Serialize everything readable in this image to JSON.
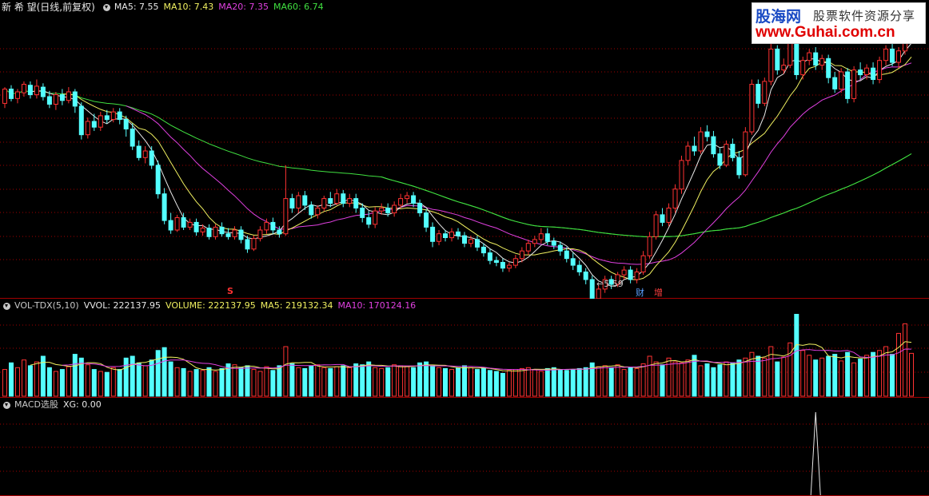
{
  "main_panel": {
    "title": "新 希 望(日线,前复权)",
    "ma_labels": [
      {
        "text": "MA5: 7.55",
        "color": "#e8e8e8"
      },
      {
        "text": "MA10: 7.43",
        "color": "#f0f060"
      },
      {
        "text": "MA20: 7.35",
        "color": "#e040e0"
      },
      {
        "text": "MA60: 6.74",
        "color": "#40e040"
      }
    ],
    "annotations": {
      "low_price": "5.59",
      "marker_s": "S",
      "marker_cai": "财",
      "marker_zeng": "增"
    }
  },
  "volume_panel": {
    "title": "VOL-TDX(5,10)",
    "labels": [
      {
        "text": "VVOL: 222137.95",
        "color": "#e8e8e8"
      },
      {
        "text": "VOLUME: 222137.95",
        "color": "#f0f060"
      },
      {
        "text": "MA5: 219132.34",
        "color": "#f0f060"
      },
      {
        "text": "MA10: 170124.16",
        "color": "#e040e0"
      }
    ]
  },
  "indicator_panel": {
    "title": "MACD选股",
    "labels": [
      {
        "text": "XG: 0.00",
        "color": "#e8e8e8"
      }
    ]
  },
  "watermark": {
    "brand": "股海网",
    "slogan": "股票软件资源分享",
    "url": "www.Guhai.com.cn"
  },
  "colors": {
    "up": "#ff3232",
    "down": "#54ffff",
    "ma5": "#e8e8e8",
    "ma10": "#f0f060",
    "ma20": "#e040e0",
    "ma60": "#40e040",
    "grid": "#a00000"
  },
  "chart_data": {
    "type": "candlestick",
    "price_range": [
      5.3,
      8.05
    ],
    "candles": [
      [
        7.15,
        7.3,
        7.32,
        7.1
      ],
      [
        7.3,
        7.2,
        7.34,
        7.17
      ],
      [
        7.2,
        7.27,
        7.3,
        7.15
      ],
      [
        7.26,
        7.35,
        7.38,
        7.22
      ],
      [
        7.34,
        7.24,
        7.38,
        7.2
      ],
      [
        7.24,
        7.33,
        7.4,
        7.2
      ],
      [
        7.32,
        7.22,
        7.36,
        7.18
      ],
      [
        7.22,
        7.14,
        7.28,
        7.1
      ],
      [
        7.14,
        7.24,
        7.27,
        7.08
      ],
      [
        7.24,
        7.18,
        7.3,
        7.13
      ],
      [
        7.18,
        7.27,
        7.32,
        7.15
      ],
      [
        7.27,
        7.12,
        7.3,
        7.05
      ],
      [
        7.12,
        6.82,
        7.16,
        6.77
      ],
      [
        6.82,
        6.96,
        7.0,
        6.78
      ],
      [
        6.96,
        6.9,
        7.04,
        6.86
      ],
      [
        6.9,
        7.02,
        7.06,
        6.86
      ],
      [
        7.02,
        6.98,
        7.08,
        6.94
      ],
      [
        6.98,
        7.06,
        7.1,
        6.95
      ],
      [
        7.06,
        6.98,
        7.1,
        6.93
      ],
      [
        6.98,
        6.88,
        7.02,
        6.8
      ],
      [
        6.88,
        6.7,
        6.94,
        6.66
      ],
      [
        6.7,
        6.58,
        6.76,
        6.55
      ],
      [
        6.58,
        6.65,
        6.7,
        6.52
      ],
      [
        6.65,
        6.5,
        6.7,
        6.46
      ],
      [
        6.5,
        6.2,
        6.55,
        6.15
      ],
      [
        6.2,
        5.92,
        6.26,
        5.88
      ],
      [
        5.92,
        5.82,
        6.0,
        5.78
      ],
      [
        5.82,
        5.95,
        5.98,
        5.8
      ],
      [
        5.95,
        5.85,
        6.0,
        5.82
      ],
      [
        5.85,
        5.9,
        5.94,
        5.82
      ],
      [
        5.9,
        5.8,
        5.94,
        5.76
      ],
      [
        5.8,
        5.84,
        5.88,
        5.76
      ],
      [
        5.84,
        5.75,
        5.88,
        5.72
      ],
      [
        5.75,
        5.85,
        5.88,
        5.72
      ],
      [
        5.85,
        5.78,
        5.9,
        5.75
      ],
      [
        5.78,
        5.75,
        5.84,
        5.72
      ],
      [
        5.75,
        5.82,
        5.86,
        5.72
      ],
      [
        5.82,
        5.72,
        5.86,
        5.68
      ],
      [
        5.72,
        5.62,
        5.76,
        5.58
      ],
      [
        5.62,
        5.73,
        5.76,
        5.6
      ],
      [
        5.73,
        5.82,
        5.86,
        5.7
      ],
      [
        5.82,
        5.9,
        5.94,
        5.78
      ],
      [
        5.9,
        5.82,
        5.95,
        5.78
      ],
      [
        5.82,
        5.78,
        5.86,
        5.74
      ],
      [
        5.78,
        6.15,
        6.5,
        5.76
      ],
      [
        6.15,
        6.05,
        6.2,
        6.0
      ],
      [
        6.05,
        6.18,
        6.22,
        6.0
      ],
      [
        6.18,
        6.08,
        6.23,
        6.03
      ],
      [
        6.08,
        5.98,
        6.12,
        5.94
      ],
      [
        5.98,
        6.05,
        6.08,
        5.94
      ],
      [
        6.05,
        6.15,
        6.18,
        6.02
      ],
      [
        6.15,
        6.1,
        6.22,
        6.06
      ],
      [
        6.1,
        6.2,
        6.25,
        6.08
      ],
      [
        6.2,
        6.1,
        6.24,
        6.06
      ],
      [
        6.1,
        6.15,
        6.2,
        6.06
      ],
      [
        6.15,
        6.05,
        6.2,
        6.0
      ],
      [
        6.05,
        5.95,
        6.1,
        5.9
      ],
      [
        5.95,
        5.88,
        6.02,
        5.84
      ],
      [
        5.88,
        6.02,
        6.06,
        5.84
      ],
      [
        6.02,
        6.05,
        6.1,
        5.98
      ],
      [
        6.05,
        6.0,
        6.1,
        5.96
      ],
      [
        6.0,
        6.08,
        6.12,
        5.96
      ],
      [
        6.08,
        6.15,
        6.2,
        6.05
      ],
      [
        6.15,
        6.18,
        6.22,
        6.1
      ],
      [
        6.18,
        6.1,
        6.22,
        6.06
      ],
      [
        6.1,
        6.0,
        6.14,
        5.96
      ],
      [
        6.0,
        5.85,
        6.04,
        5.8
      ],
      [
        5.85,
        5.7,
        5.9,
        5.64
      ],
      [
        5.7,
        5.78,
        5.82,
        5.66
      ],
      [
        5.78,
        5.74,
        5.82,
        5.7
      ],
      [
        5.74,
        5.8,
        5.84,
        5.7
      ],
      [
        5.8,
        5.76,
        5.84,
        5.72
      ],
      [
        5.76,
        5.68,
        5.8,
        5.64
      ],
      [
        5.68,
        5.72,
        5.76,
        5.64
      ],
      [
        5.72,
        5.64,
        5.76,
        5.6
      ],
      [
        5.64,
        5.58,
        5.68,
        5.54
      ],
      [
        5.58,
        5.5,
        5.62,
        5.46
      ],
      [
        5.5,
        5.48,
        5.54,
        5.44
      ],
      [
        5.48,
        5.42,
        5.52,
        5.38
      ],
      [
        5.42,
        5.45,
        5.48,
        5.38
      ],
      [
        5.45,
        5.52,
        5.56,
        5.42
      ],
      [
        5.52,
        5.6,
        5.64,
        5.48
      ],
      [
        5.6,
        5.68,
        5.72,
        5.56
      ],
      [
        5.68,
        5.72,
        5.76,
        5.64
      ],
      [
        5.72,
        5.78,
        5.84,
        5.68
      ],
      [
        5.78,
        5.7,
        5.84,
        5.66
      ],
      [
        5.7,
        5.66,
        5.74,
        5.62
      ],
      [
        5.66,
        5.6,
        5.7,
        5.55
      ],
      [
        5.6,
        5.52,
        5.64,
        5.48
      ],
      [
        5.52,
        5.45,
        5.58,
        5.4
      ],
      [
        5.45,
        5.38,
        5.5,
        5.34
      ],
      [
        5.38,
        5.3,
        5.42,
        5.25
      ],
      [
        5.3,
        5.1,
        5.34,
        4.98
      ],
      [
        5.1,
        5.2,
        5.24,
        5.06
      ],
      [
        5.2,
        5.3,
        5.34,
        5.16
      ],
      [
        5.3,
        5.25,
        5.34,
        5.2
      ],
      [
        5.25,
        5.35,
        5.38,
        5.22
      ],
      [
        5.35,
        5.4,
        5.44,
        5.3
      ],
      [
        5.4,
        5.3,
        5.44,
        5.26
      ],
      [
        5.3,
        5.38,
        5.42,
        5.26
      ],
      [
        5.38,
        5.55,
        5.6,
        5.35
      ],
      [
        5.55,
        5.75,
        5.8,
        5.52
      ],
      [
        5.75,
        5.98,
        6.02,
        5.72
      ],
      [
        5.98,
        5.9,
        6.05,
        5.86
      ],
      [
        5.9,
        6.05,
        6.1,
        5.86
      ],
      [
        6.05,
        6.25,
        6.3,
        6.0
      ],
      [
        6.25,
        6.55,
        6.6,
        6.2
      ],
      [
        6.55,
        6.7,
        6.75,
        6.5
      ],
      [
        6.7,
        6.65,
        6.8,
        6.6
      ],
      [
        6.65,
        6.85,
        6.9,
        6.62
      ],
      [
        6.85,
        6.8,
        6.92,
        6.75
      ],
      [
        6.8,
        6.62,
        6.86,
        6.58
      ],
      [
        6.62,
        6.5,
        6.68,
        6.46
      ],
      [
        6.5,
        6.72,
        6.76,
        6.48
      ],
      [
        6.72,
        6.58,
        6.78,
        6.54
      ],
      [
        6.58,
        6.4,
        6.65,
        6.36
      ],
      [
        6.4,
        6.85,
        6.9,
        6.38
      ],
      [
        6.85,
        7.35,
        7.4,
        6.82
      ],
      [
        7.35,
        7.15,
        7.4,
        7.1
      ],
      [
        7.15,
        7.38,
        7.42,
        7.12
      ],
      [
        7.38,
        7.72,
        7.78,
        7.34
      ],
      [
        7.72,
        7.5,
        7.76,
        7.45
      ],
      [
        7.5,
        7.55,
        7.62,
        7.46
      ],
      [
        7.55,
        7.8,
        7.86,
        7.52
      ],
      [
        7.8,
        7.45,
        7.82,
        7.4
      ],
      [
        7.45,
        7.6,
        7.64,
        7.4
      ],
      [
        7.6,
        7.68,
        7.72,
        7.55
      ],
      [
        7.68,
        7.55,
        7.74,
        7.5
      ],
      [
        7.55,
        7.62,
        7.66,
        7.5
      ],
      [
        7.62,
        7.42,
        7.66,
        7.36
      ],
      [
        7.42,
        7.3,
        7.48,
        7.26
      ],
      [
        7.3,
        7.48,
        7.52,
        7.26
      ],
      [
        7.48,
        7.2,
        7.52,
        7.15
      ],
      [
        7.2,
        7.5,
        7.54,
        7.16
      ],
      [
        7.5,
        7.45,
        7.58,
        7.4
      ],
      [
        7.45,
        7.52,
        7.56,
        7.4
      ],
      [
        7.52,
        7.4,
        7.58,
        7.35
      ],
      [
        7.4,
        7.6,
        7.64,
        7.36
      ],
      [
        7.6,
        7.72,
        7.76,
        7.55
      ],
      [
        7.72,
        7.58,
        7.78,
        7.54
      ],
      [
        7.58,
        7.7,
        7.74,
        7.52
      ],
      [
        7.7,
        7.9,
        7.95,
        7.66
      ],
      [
        7.9,
        8.0,
        8.04,
        7.85
      ]
    ],
    "volume_range": [
      0,
      470000
    ],
    "volumes": [
      140000,
      175000,
      150000,
      190000,
      160000,
      180000,
      210000,
      150000,
      130000,
      140000,
      155000,
      220000,
      200000,
      165000,
      140000,
      130000,
      125000,
      150000,
      140000,
      200000,
      210000,
      175000,
      160000,
      190000,
      240000,
      255000,
      180000,
      150000,
      145000,
      130000,
      140000,
      135000,
      150000,
      130000,
      145000,
      170000,
      165000,
      150000,
      160000,
      140000,
      130000,
      155000,
      135000,
      160000,
      260000,
      170000,
      150000,
      145000,
      160000,
      165000,
      150000,
      145000,
      155000,
      160000,
      150000,
      170000,
      165000,
      180000,
      150000,
      145000,
      150000,
      165000,
      160000,
      155000,
      150000,
      175000,
      180000,
      160000,
      150000,
      145000,
      140000,
      150000,
      160000,
      150000,
      140000,
      145000,
      135000,
      130000,
      120000,
      135000,
      140000,
      145000,
      150000,
      140000,
      130000,
      145000,
      150000,
      140000,
      135000,
      140000,
      145000,
      150000,
      175000,
      155000,
      160000,
      150000,
      165000,
      140000,
      150000,
      145000,
      170000,
      210000,
      180000,
      165000,
      200000,
      180000,
      175000,
      190000,
      215000,
      160000,
      170000,
      150000,
      165000,
      180000,
      175000,
      190000,
      200000,
      230000,
      210000,
      200000,
      260000,
      180000,
      205000,
      280000,
      430000,
      240000,
      215000,
      190000,
      200000,
      210000,
      220000,
      185000,
      230000,
      175000,
      195000,
      215000,
      230000,
      240000,
      260000,
      220000,
      330000,
      380000,
      225000
    ],
    "xg_signal_index": 127
  }
}
